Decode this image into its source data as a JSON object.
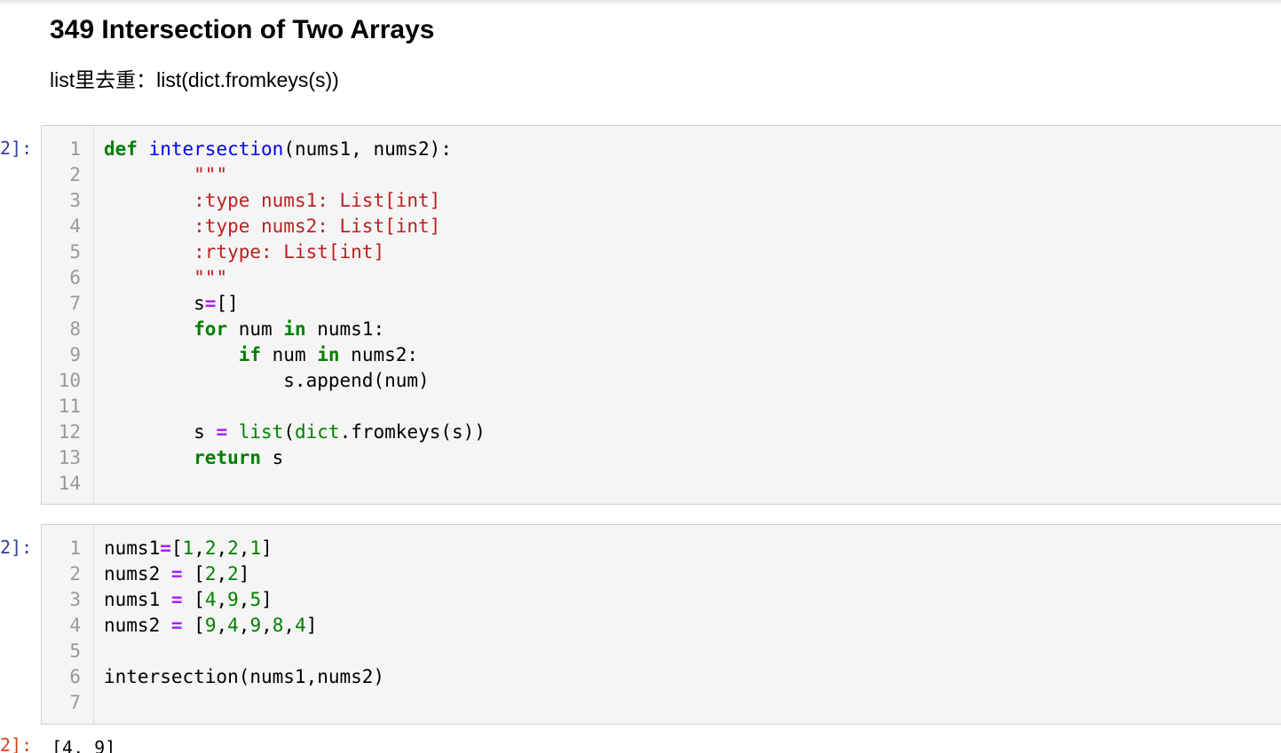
{
  "markdown": {
    "heading": "349 Intersection of Two Arrays",
    "note": "list里去重：list(dict.fromkeys(s))"
  },
  "cell1": {
    "prompt": "2]:",
    "line_numbers": [
      "1",
      "2",
      "3",
      "4",
      "5",
      "6",
      "7",
      "8",
      "9",
      "10",
      "11",
      "12",
      "13",
      "14"
    ],
    "code_lines": [
      "def intersection(nums1, nums2):",
      "        \"\"\"",
      "        :type nums1: List[int]",
      "        :type nums2: List[int]",
      "        :rtype: List[int]",
      "        \"\"\"",
      "        s=[]",
      "        for num in nums1:",
      "            if num in nums2:",
      "                s.append(num)",
      "",
      "        s = list(dict.fromkeys(s))",
      "        return s",
      ""
    ]
  },
  "cell2": {
    "prompt": "2]:",
    "line_numbers": [
      "1",
      "2",
      "3",
      "4",
      "5",
      "6",
      "7"
    ],
    "code_lines": [
      "nums1=[1,2,2,1]",
      "nums2 = [2,2]",
      "nums1 = [4,9,5]",
      "nums2 = [9,4,9,8,4]",
      "",
      "intersection(nums1,nums2)",
      ""
    ]
  },
  "output": {
    "prompt": "2]:",
    "text": "[4, 9]"
  },
  "colors": {
    "prompt_in": "#303f9f",
    "prompt_out": "#d84315",
    "keyword": "#008000",
    "function_name": "#0000ff",
    "string": "#ba2121",
    "operator": "#aa22ff",
    "cell_background": "#f5f5f5"
  }
}
